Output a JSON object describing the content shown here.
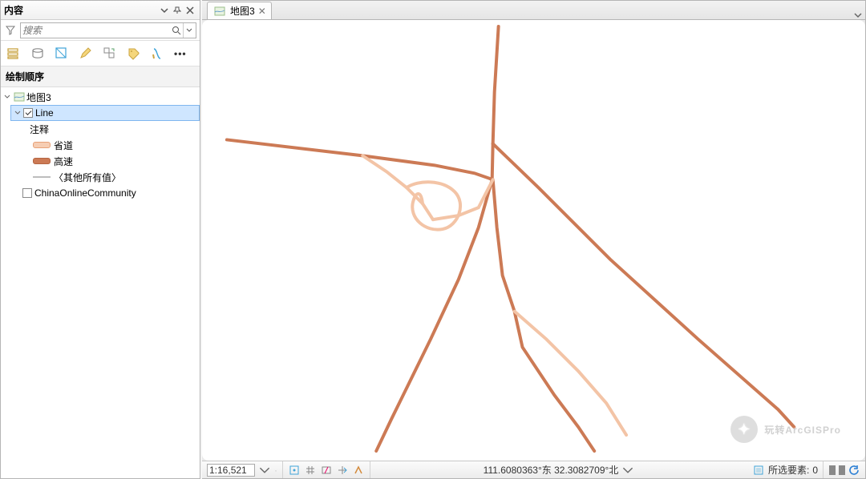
{
  "contents": {
    "title": "内容",
    "search_placeholder": "搜索",
    "section_title": "绘制顺序",
    "map_name": "地图3",
    "layer_line": "Line",
    "anno_label": "注释",
    "legend_shengdao": "省道",
    "legend_gaosu": "高速",
    "legend_other": "〈其他所有值〉",
    "basemap": "ChinaOnlineCommunity"
  },
  "view": {
    "tab_label": "地图3"
  },
  "status": {
    "scale": "1:16,521",
    "coords": "111.6080363°东 32.3082709°北",
    "selection_label": "所选要素:",
    "selection_count": "0"
  },
  "watermark": "玩转ArcGISPro",
  "colors": {
    "shengdao": "#f3c4a6",
    "gaosu": "#cc7a55"
  }
}
